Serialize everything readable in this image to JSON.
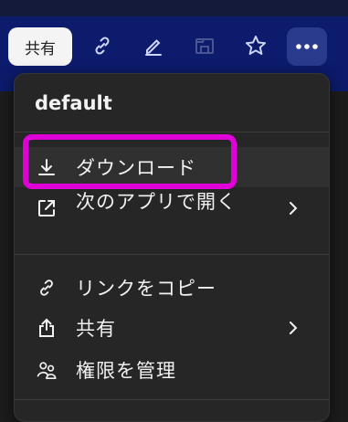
{
  "toolbar": {
    "share_label": "共有",
    "icons": [
      "link-icon",
      "edit-icon",
      "save-icon",
      "favorite-star-icon",
      "more-options-icon"
    ]
  },
  "menu": {
    "title": "default",
    "items": [
      {
        "label": "ダウンロード",
        "icon": "download-icon",
        "has_submenu": false
      },
      {
        "label": "次のアプリで開く",
        "icon": "open-external-icon",
        "has_submenu": true
      },
      {
        "label": "リンクをコピー",
        "icon": "link-icon",
        "has_submenu": false
      },
      {
        "label": "共有",
        "icon": "share-upload-icon",
        "has_submenu": true
      },
      {
        "label": "権限を管理",
        "icon": "people-icon",
        "has_submenu": false
      }
    ]
  },
  "colors": {
    "toolbar_bg": "#0c1b6b",
    "menu_bg": "#262626",
    "highlight_border": "#e000d8"
  }
}
